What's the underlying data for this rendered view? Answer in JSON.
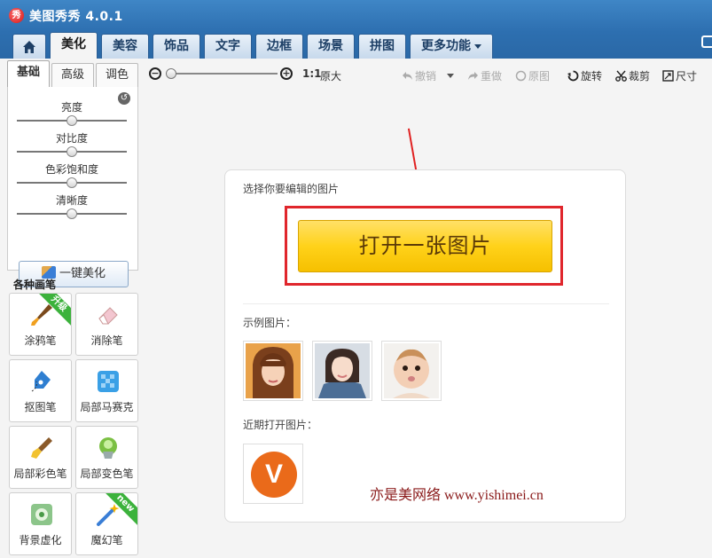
{
  "app": {
    "title": "美图秀秀 4.0.1",
    "logo_text": "秀"
  },
  "tabs": [
    {
      "label": "美化",
      "active": true
    },
    {
      "label": "美容"
    },
    {
      "label": "饰品"
    },
    {
      "label": "文字"
    },
    {
      "label": "边框"
    },
    {
      "label": "场景"
    },
    {
      "label": "拼图"
    },
    {
      "label": "更多功能"
    }
  ],
  "subtabs": [
    {
      "label": "基础",
      "active": true
    },
    {
      "label": "高级"
    },
    {
      "label": "调色"
    }
  ],
  "adjustments": [
    {
      "label": "亮度",
      "value": 0.5
    },
    {
      "label": "对比度",
      "value": 0.5
    },
    {
      "label": "色彩饱和度",
      "value": 0.5
    },
    {
      "label": "清晰度",
      "value": 0.5
    }
  ],
  "one_click_label": "一键美化",
  "brushes_title": "各种画笔",
  "brushes": [
    {
      "label": "涂鸦笔",
      "icon": "paintbrush-icon",
      "badge": "升级"
    },
    {
      "label": "消除笔",
      "icon": "eraser-icon"
    },
    {
      "label": "抠图笔",
      "icon": "pen-nib-icon"
    },
    {
      "label": "局部马赛克",
      "icon": "mosaic-icon"
    },
    {
      "label": "局部彩色笔",
      "icon": "color-brush-icon"
    },
    {
      "label": "局部变色笔",
      "icon": "paint-bucket-icon"
    },
    {
      "label": "背景虚化",
      "icon": "blur-icon"
    },
    {
      "label": "魔幻笔",
      "icon": "magic-wand-icon",
      "badge": "new"
    }
  ],
  "toolbar": {
    "zoom_level": 0,
    "ratio": "1:1",
    "actual_size": "原大",
    "undo": "撤销",
    "redo": "重做",
    "original": "原图",
    "rotate": "旋转",
    "crop": "裁剪",
    "resize": "尺寸"
  },
  "main": {
    "select_prompt": "选择你要编辑的图片",
    "open_button": "打开一张图片",
    "sample_label": "示例图片：",
    "recent_label": "近期打开图片：",
    "recent_logo_text": "V",
    "watermark": "亦是美网络 www.yishimei.cn"
  },
  "colors": {
    "title_bar": "#2d6fb0",
    "open_button": "#ffd21a",
    "highlight_box": "#e0262c",
    "arrow": "#e02020"
  }
}
